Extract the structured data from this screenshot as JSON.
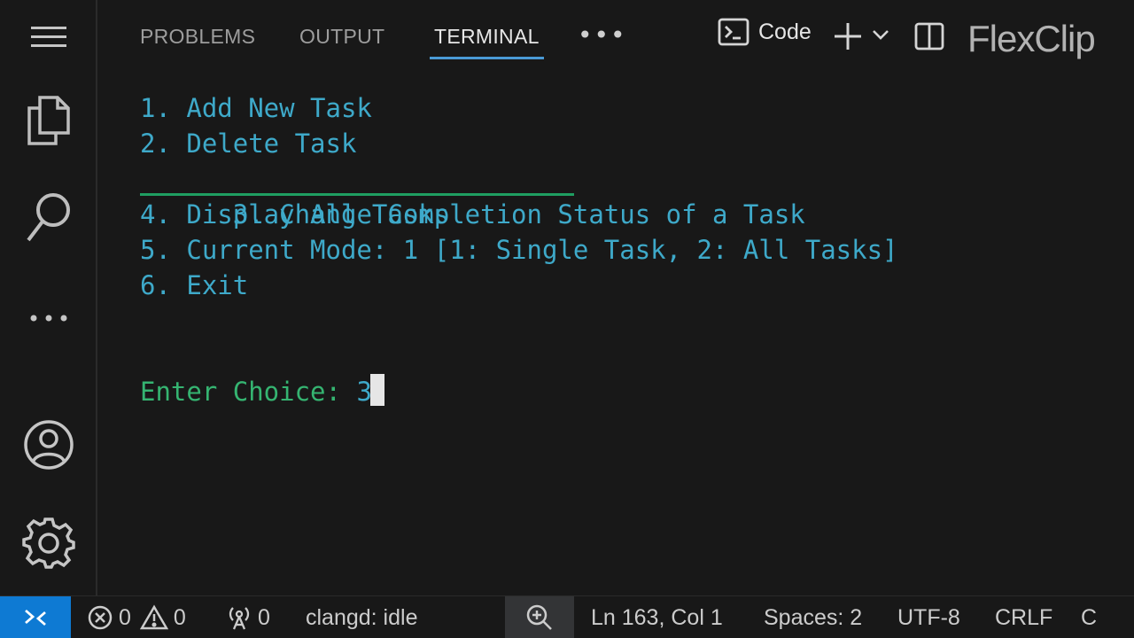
{
  "activity_bar": {
    "items": [
      {
        "name": "menu-icon"
      },
      {
        "name": "explorer-icon"
      },
      {
        "name": "search-icon"
      },
      {
        "name": "more-icon"
      },
      {
        "name": "accounts-icon"
      },
      {
        "name": "manage-gear-icon"
      }
    ]
  },
  "panel": {
    "tabs": [
      {
        "label": "PROBLEMS",
        "active": false
      },
      {
        "label": "OUTPUT",
        "active": false
      },
      {
        "label": "TERMINAL",
        "active": true
      }
    ],
    "more_label": "•••",
    "terminal_profile_label": "Code",
    "watermark": "FlexClip"
  },
  "terminal": {
    "menu": [
      "1. Add New Task",
      "2. Delete Task",
      "3. Change Completion Status of a Task",
      "4. Display All Tasks",
      "5. Current Mode: 1 [1: Single Task, 2: All Tasks]",
      "6. Exit"
    ],
    "prompt_label": "Enter Choice: ",
    "prompt_value": "3"
  },
  "status_bar": {
    "errors": "0",
    "warnings": "0",
    "ports": "0",
    "language_server": "clangd: idle",
    "cursor_position": "Ln 163, Col 1",
    "indentation": "Spaces: 2",
    "encoding": "UTF-8",
    "line_ending": "CRLF",
    "language": "C"
  },
  "colors": {
    "accent": "#0e7ad3",
    "tab_underline": "#4a9ad6",
    "terminal_text": "#3ea9c9",
    "prompt_text": "#35b471"
  }
}
